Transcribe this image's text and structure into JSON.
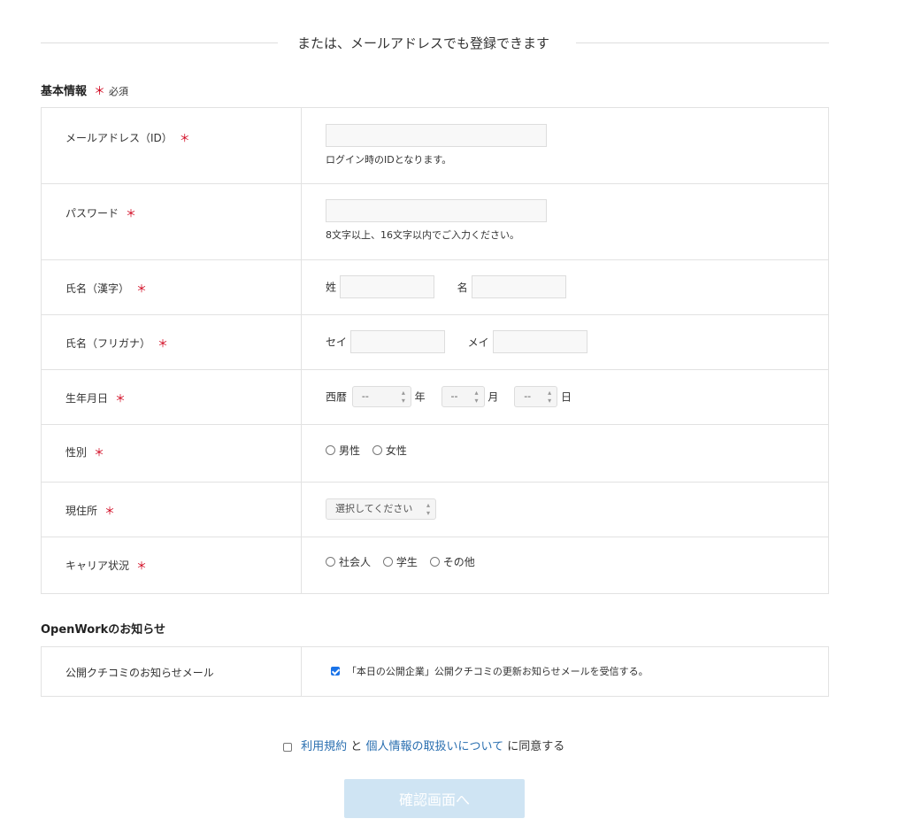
{
  "divider": {
    "text": "または、メールアドレスでも登録できます"
  },
  "basic": {
    "title": "基本情報",
    "required_mark": "＊",
    "required_label": "必須",
    "email": {
      "label": "メールアドレス（ID）",
      "hint": "ログイン時のIDとなります。"
    },
    "password": {
      "label": "パスワード",
      "hint": "8文字以上、16文字以内でご入力ください。"
    },
    "name_kanji": {
      "label": "氏名（漢字）",
      "last": "姓",
      "first": "名"
    },
    "name_kana": {
      "label": "氏名（フリガナ）",
      "last": "セイ",
      "first": "メイ"
    },
    "birthday": {
      "label": "生年月日",
      "era": "西暦",
      "placeholder": "--",
      "year": "年",
      "month": "月",
      "day": "日"
    },
    "gender": {
      "label": "性別",
      "options": [
        "男性",
        "女性"
      ]
    },
    "address": {
      "label": "現住所",
      "placeholder": "選択してください"
    },
    "career": {
      "label": "キャリア状況",
      "options": [
        "社会人",
        "学生",
        "その他"
      ]
    }
  },
  "notice": {
    "title": "OpenWorkのお知らせ",
    "label": "公開クチコミのお知らせメール",
    "checkbox_text": "「本日の公開企業」公開クチコミの更新お知らせメールを受信する。",
    "checked": true
  },
  "agree": {
    "terms": "利用規約",
    "and": "と",
    "privacy": "個人情報の取扱いについて",
    "suffix": "に同意する"
  },
  "submit": {
    "label": "確認画面へ"
  },
  "colors": {
    "required": "#d0021b",
    "link": "#2a6fb0",
    "submit_bg": "#cfe4f3"
  }
}
